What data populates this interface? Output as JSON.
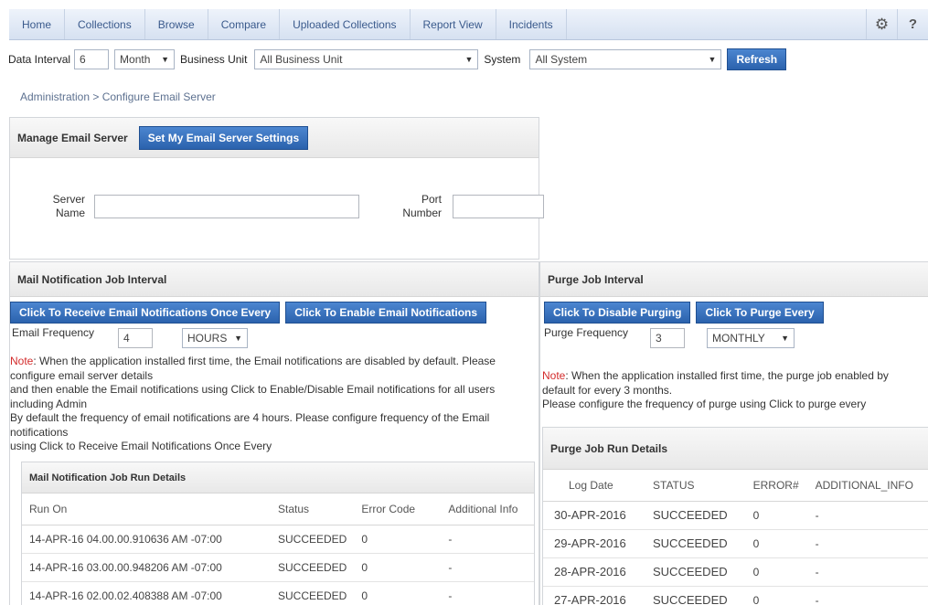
{
  "nav": {
    "items": [
      "Home",
      "Collections",
      "Browse",
      "Compare",
      "Uploaded Collections",
      "Report View",
      "Incidents"
    ],
    "icons": [
      "gear-icon",
      "help-icon"
    ]
  },
  "filter": {
    "data_interval_label": "Data Interval",
    "data_interval_value": "6",
    "period_value": "Month",
    "business_unit_label": "Business Unit",
    "business_unit_value": "All Business Unit",
    "system_label": "System",
    "system_value": "All System",
    "refresh_label": "Refresh"
  },
  "breadcrumb": "Administration  >  Configure Email Server",
  "email_server": {
    "title": "Manage Email Server",
    "settings_button": "Set My Email Server Settings",
    "server_name_label_1": "Server",
    "server_name_label_2": "Name",
    "port_label_1": "Port",
    "port_label_2": "Number"
  },
  "mail_job": {
    "title": "Mail Notification Job Interval",
    "receive_button": "Click To Receive Email Notifications Once Every",
    "enable_button": "Click To Enable Email Notifications",
    "frequency_label": "Email Frequency",
    "frequency_value": "4",
    "unit_value": "HOURS",
    "note_prefix": "Note",
    "note_lines": [
      ": When the application installed first time, the Email notifications are disabled by default. Please",
      "configure email server details",
      "and then enable the Email notifications using Click to Enable/Disable Email notifications for all users",
      "including Admin",
      "By default the frequency of email notifications are 4 hours. Please configure frequency of the Email",
      "notifications",
      "using Click to Receive Email Notifications Once Every"
    ],
    "run_details": {
      "title": "Mail Notification Job Run Details",
      "columns": [
        "Run On",
        "Status",
        "Error Code",
        "Additional Info"
      ],
      "rows": [
        [
          "14-APR-16 04.00.00.910636 AM -07:00",
          "SUCCEEDED",
          "0",
          "-"
        ],
        [
          "14-APR-16 03.00.00.948206 AM -07:00",
          "SUCCEEDED",
          "0",
          "-"
        ],
        [
          "14-APR-16 02.00.02.408388 AM -07:00",
          "SUCCEEDED",
          "0",
          "-"
        ]
      ]
    }
  },
  "purge_job": {
    "title": "Purge Job Interval",
    "disable_button": "Click To Disable Purging",
    "purge_every_button": "Click To Purge Every",
    "frequency_label": "Purge Frequency",
    "frequency_value": "3",
    "unit_value": "MONTHLY",
    "note_prefix": "Note",
    "note_lines": [
      ": When the application installed first time, the purge job enabled by",
      "default for every 3 months.",
      "Please configure the frequency of purge using Click to purge every"
    ],
    "run_details": {
      "title": "Purge Job Run Details",
      "columns": [
        "Log Date",
        "STATUS",
        "ERROR#",
        "ADDITIONAL_INFO"
      ],
      "rows": [
        [
          "30-APR-2016",
          "SUCCEEDED",
          "0",
          "-"
        ],
        [
          "29-APR-2016",
          "SUCCEEDED",
          "0",
          "-"
        ],
        [
          "28-APR-2016",
          "SUCCEEDED",
          "0",
          "-"
        ],
        [
          "27-APR-2016",
          "SUCCEEDED",
          "0",
          "-"
        ]
      ]
    }
  }
}
